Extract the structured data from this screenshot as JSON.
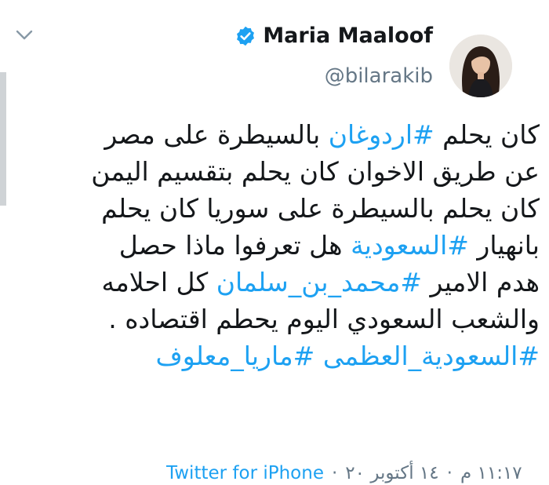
{
  "tweet": {
    "author": {
      "display_name": "Maria Maaloof",
      "handle": "@bilarakib",
      "verified": true
    },
    "lines": [
      [
        {
          "text": "كان يحلم ",
          "type": "text"
        },
        {
          "text": "#اردوغان",
          "type": "hashtag"
        },
        {
          "text": " بالسيطرة على مصر",
          "type": "text"
        }
      ],
      [
        {
          "text": "عن طريق الاخوان كان يحلم بتقسيم اليمن",
          "type": "text"
        }
      ],
      [
        {
          "text": "كان يحلم بالسيطرة على سوريا كان يحلم",
          "type": "text"
        }
      ],
      [
        {
          "text": "بانهيار ",
          "type": "text"
        },
        {
          "text": "#السعودية",
          "type": "hashtag"
        },
        {
          "text": " هل تعرفوا ماذا حصل",
          "type": "text"
        }
      ],
      [
        {
          "text": "هدم الامير ",
          "type": "text"
        },
        {
          "text": "#محمد_بن_سلمان",
          "type": "hashtag"
        },
        {
          "text": " كل احلامه",
          "type": "text"
        }
      ],
      [
        {
          "text": "والشعب السعودي اليوم يحطم اقتصاده .",
          "type": "text"
        }
      ],
      [
        {
          "text": "#السعودية_العظمى",
          "type": "hashtag"
        },
        {
          "text": " ",
          "type": "text"
        },
        {
          "text": "#ماريا_معلوف",
          "type": "hashtag"
        }
      ]
    ],
    "meta": {
      "time": "١١:١٧ م",
      "date": "١٤ أكتوبر ٢٠",
      "separator": "·",
      "source": "Twitter for iPhone"
    }
  },
  "colors": {
    "hashtag": "#1da1f2",
    "text": "#14171a",
    "secondary": "#657786",
    "verified_badge": "#1da1f2"
  },
  "icons": {
    "chevron": "chevron-down-icon",
    "verified": "verified-badge-icon"
  }
}
